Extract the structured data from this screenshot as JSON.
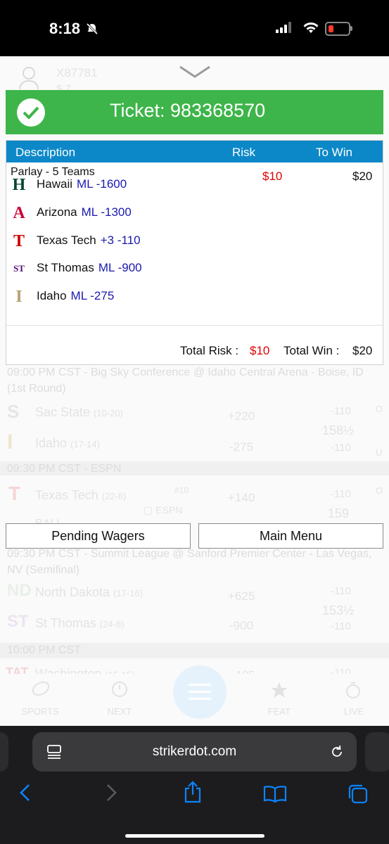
{
  "status_bar": {
    "time": "8:18"
  },
  "background": {
    "user_id": "X87781",
    "balance_partial": "$ 7",
    "game1_header": "09:00 PM CST - Big Sky Conference @ Idaho Central Arena - Boise, ID (1st Round)",
    "game1_team1": "Sac State",
    "game1_team1_rec": "(10-20)",
    "game1_team1_ml": "+220",
    "game1_team1_spread": "-110",
    "game1_total": "158½",
    "game1_team2": "Idaho",
    "game1_team2_rec": "(17-14)",
    "game1_team2_ml": "-275",
    "game1_team2_spread": "-110",
    "game1_ou_marker": "U",
    "game1_ou_top_marker": "O",
    "game2_header": "09:30 PM CST - ESPN",
    "game2_team1": "Texas Tech",
    "game2_team1_rec": "(22-8)",
    "game2_rank": "#10",
    "game2_team1_ml": "+140",
    "game2_team1_spread": "-110",
    "game2_total": "159",
    "game2_network": "ESPN",
    "game2_team2_partial": "BALL",
    "game3_header": "09:30 PM CST - Summit League @ Sanford Premier Center - Las Vegas, NV (Semifinal)",
    "game3_team1": "North Dakota",
    "game3_team1_rec": "(17-16)",
    "game3_team1_ml": "+625",
    "game3_team1_spread": "-110",
    "game3_total": "153½",
    "game3_team2": "St Thomas",
    "game3_team2_rec": "(24-8)",
    "game3_team2_ml": "-900",
    "game3_team2_spread": "-110",
    "game4_header": "10:00 PM CST",
    "game4_team1": "Washington",
    "game4_team1_rec": "(15-15)",
    "game4_team1_ml": "-105",
    "game4_team1_spread": "-110",
    "top_total_partial": "145"
  },
  "ticket": {
    "title": "Ticket: 983368570",
    "columns": {
      "description": "Description",
      "risk": "Risk",
      "to_win": "To Win"
    },
    "bet_type": "Parlay - 5 Teams",
    "risk": "$10",
    "to_win": "$20",
    "legs": [
      {
        "team": "Hawaii",
        "pick": "ML -1600",
        "logo_color": "#024731",
        "logo_letter": "H"
      },
      {
        "team": "Arizona",
        "pick": "ML -1300",
        "logo_color": "#cc0033",
        "logo_letter": "A"
      },
      {
        "team": "Texas Tech",
        "pick": "+3 -110",
        "logo_color": "#cc0000",
        "logo_letter": "T"
      },
      {
        "team": "St Thomas",
        "pick": "ML -900",
        "logo_color": "#510c76",
        "logo_letter": "ST"
      },
      {
        "team": "Idaho",
        "pick": "ML -275",
        "logo_color": "#b3a369",
        "logo_letter": "I"
      }
    ],
    "total_risk_label": "Total Risk :",
    "total_risk_value": "$10",
    "total_win_label": "Total Win :",
    "total_win_value": "$20"
  },
  "buttons": {
    "pending": "Pending Wagers",
    "main_menu": "Main Menu"
  },
  "bottom_nav": {
    "sports": "SPORTS",
    "next": "NEXT",
    "feat": "FEAT",
    "live": "LIVE"
  },
  "browser": {
    "url": "strikerdot.com"
  },
  "colors": {
    "green": "#3eb54a",
    "blue_header": "#0c88c8",
    "risk_red": "#e00000",
    "odds_blue": "#1a1ab0"
  }
}
